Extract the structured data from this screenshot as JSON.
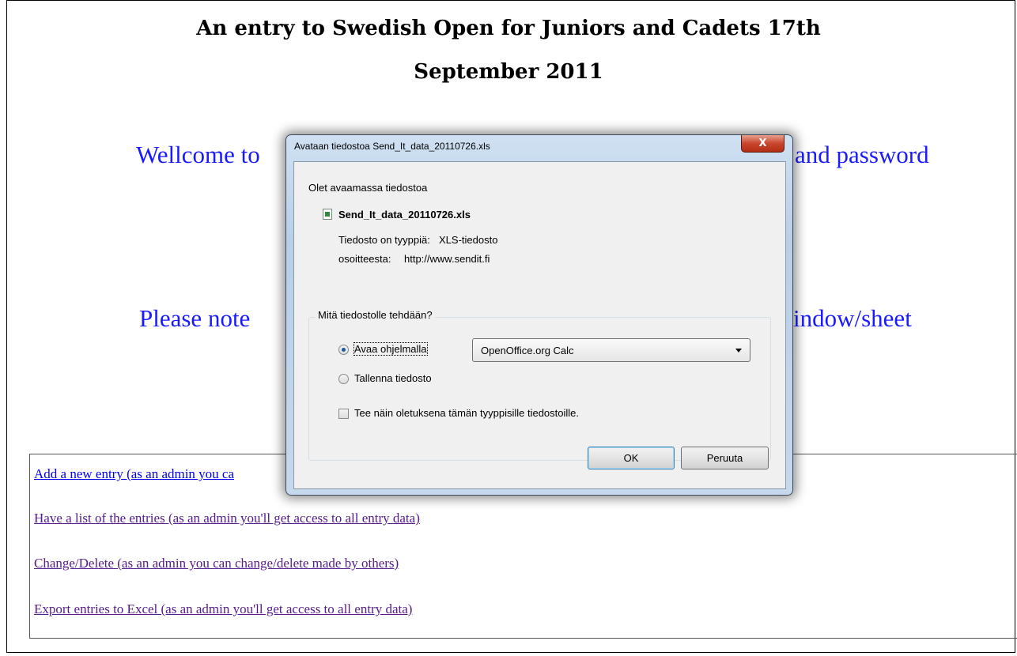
{
  "page": {
    "title_line1": "An entry to Swedish Open for Juniors and Cadets 17th",
    "title_line2": "September 2011",
    "welcome_left": "Wellcome to",
    "welcome_right": "and password",
    "note_left": "Please note",
    "note_right": "indow/sheet",
    "links": [
      "Add a new entry (as an admin you ca",
      "Have a list of the entries (as an admin you'll get access to all entry data)",
      "Change/Delete (as an admin you can change/delete made by others)",
      "Export entries to Excel (as an admin you'll get access to all entry data)"
    ]
  },
  "dialog": {
    "title": "Avataan tiedostoa Send_It_data_20110726.xls",
    "close_label": "X",
    "intro": "Olet avaamassa tiedostoa",
    "file_name": "Send_It_data_20110726.xls",
    "file_type_label": "Tiedosto on tyyppiä:",
    "file_type_value": "XLS-tiedosto",
    "source_label": "osoitteesta:",
    "source_value": "http://www.sendit.fi",
    "group_label": "Mitä tiedostolle tehdään?",
    "open_with_label": "Avaa ohjelmalla",
    "open_with_app": "OpenOffice.org Calc",
    "save_label": "Tallenna tiedosto",
    "default_checkbox_label": "Tee näin oletuksena tämän tyyppisille tiedostoille.",
    "ok_label": "OK",
    "cancel_label": "Peruuta"
  }
}
